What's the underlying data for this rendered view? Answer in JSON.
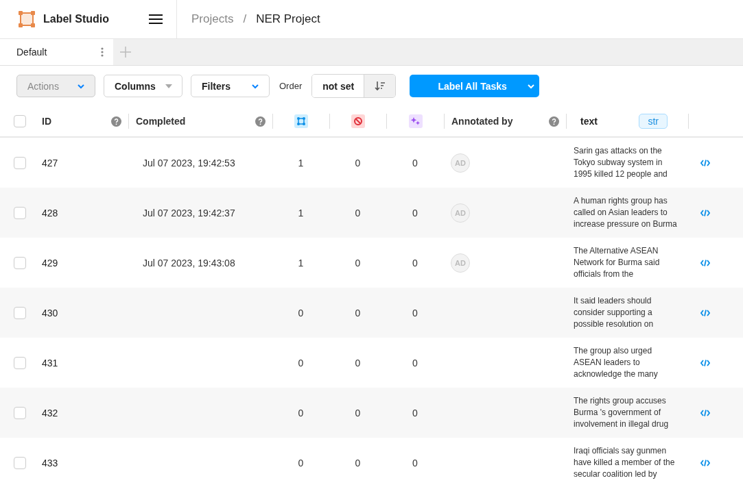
{
  "app": {
    "name": "Label Studio"
  },
  "breadcrumb": [
    {
      "label": "Projects",
      "current": false
    },
    {
      "label": "/",
      "current": false
    },
    {
      "label": "NER Project",
      "current": true
    }
  ],
  "tabs": [
    {
      "label": "Default",
      "selected": true
    }
  ],
  "toolbar": {
    "actions": {
      "label": "Actions",
      "disabled": true
    },
    "columns": "Columns",
    "filters": "Filters",
    "order_label": "Order",
    "order_value": "not set",
    "primary": "Label All Tasks"
  },
  "table": {
    "header_checked": false,
    "columns": [
      {
        "kind": "label",
        "label": "ID",
        "help": true
      },
      {
        "kind": "label",
        "label": "Completed",
        "help": true
      },
      {
        "kind": "annotations"
      },
      {
        "kind": "cancelled"
      },
      {
        "kind": "predictions"
      },
      {
        "kind": "label",
        "label": "Annotated by",
        "help": true
      },
      {
        "kind": "data",
        "label": "text",
        "badge": "str"
      }
    ],
    "rows": [
      {
        "checked": false,
        "id": "427",
        "completed": "Jul 07 2023, 19:42:53",
        "annotations": "1",
        "cancelled": "0",
        "predictions": "0",
        "annotators": [
          "AD"
        ],
        "text": "Sarin gas attacks on the\nTokyo subway system in\n1995 killed 12 people and"
      },
      {
        "checked": false,
        "id": "428",
        "completed": "Jul 07 2023, 19:42:37",
        "annotations": "1",
        "cancelled": "0",
        "predictions": "0",
        "annotators": [
          "AD"
        ],
        "text": "A human rights group has\ncalled on Asian leaders to\nincrease pressure on Burma"
      },
      {
        "checked": false,
        "id": "429",
        "completed": "Jul 07 2023, 19:43:08",
        "annotations": "1",
        "cancelled": "0",
        "predictions": "0",
        "annotators": [
          "AD"
        ],
        "text": "The Alternative ASEAN\nNetwork for Burma said\nofficials from the"
      },
      {
        "checked": false,
        "id": "430",
        "annotations": "0",
        "cancelled": "0",
        "predictions": "0",
        "text": "It said leaders should\nconsider supporting a\npossible resolution on"
      },
      {
        "checked": false,
        "id": "431",
        "annotations": "0",
        "cancelled": "0",
        "predictions": "0",
        "text": "The group also urged\nASEAN leaders to\nacknowledge the many"
      },
      {
        "checked": false,
        "id": "432",
        "annotations": "0",
        "cancelled": "0",
        "predictions": "0",
        "text": "The rights group accuses\nBurma 's government of\ninvolvement in illegal drug"
      },
      {
        "checked": false,
        "id": "433",
        "annotations": "0",
        "cancelled": "0",
        "predictions": "0",
        "text": "Iraqi officials say gunmen\nhave killed a member of the\nsecular coalition led by"
      }
    ]
  }
}
